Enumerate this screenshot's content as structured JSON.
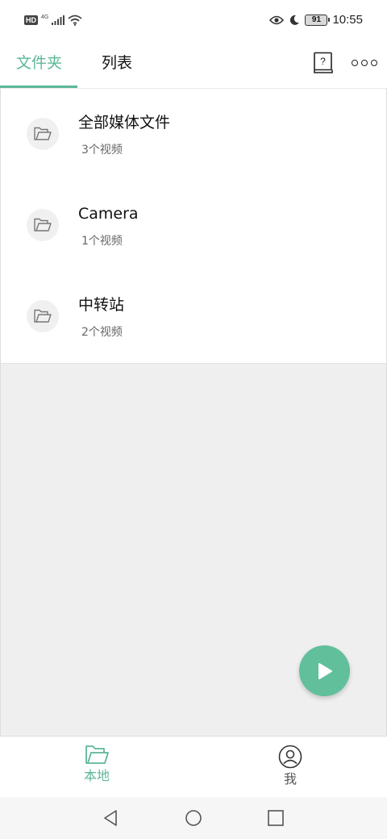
{
  "status_bar": {
    "hd_badge": "HD",
    "network_label": "4G",
    "battery_level": "91",
    "time": "10:55",
    "icons": [
      "signal-icon",
      "wifi-icon",
      "eye-icon",
      "moon-icon",
      "battery-icon"
    ]
  },
  "tabs": [
    {
      "label": "文件夹",
      "active": true
    },
    {
      "label": "列表",
      "active": false
    }
  ],
  "toolbar": {
    "help_icon": "help-book-icon",
    "more_icon": "more-dots-icon"
  },
  "folders": [
    {
      "name": "全部媒体文件",
      "count": "3个视频",
      "icon": "folder-icon"
    },
    {
      "name": "Camera",
      "count": "1个视频",
      "icon": "folder-icon"
    },
    {
      "name": "中转站",
      "count": "2个视频",
      "icon": "folder-icon"
    }
  ],
  "fab": {
    "icon": "play-icon"
  },
  "bottom_nav": [
    {
      "label": "本地",
      "icon": "folder-icon",
      "active": true
    },
    {
      "label": "我",
      "icon": "user-icon",
      "active": false
    }
  ],
  "colors": {
    "accent": "#5cb896",
    "fab": "#62bf9c",
    "background_empty": "#efefef"
  }
}
